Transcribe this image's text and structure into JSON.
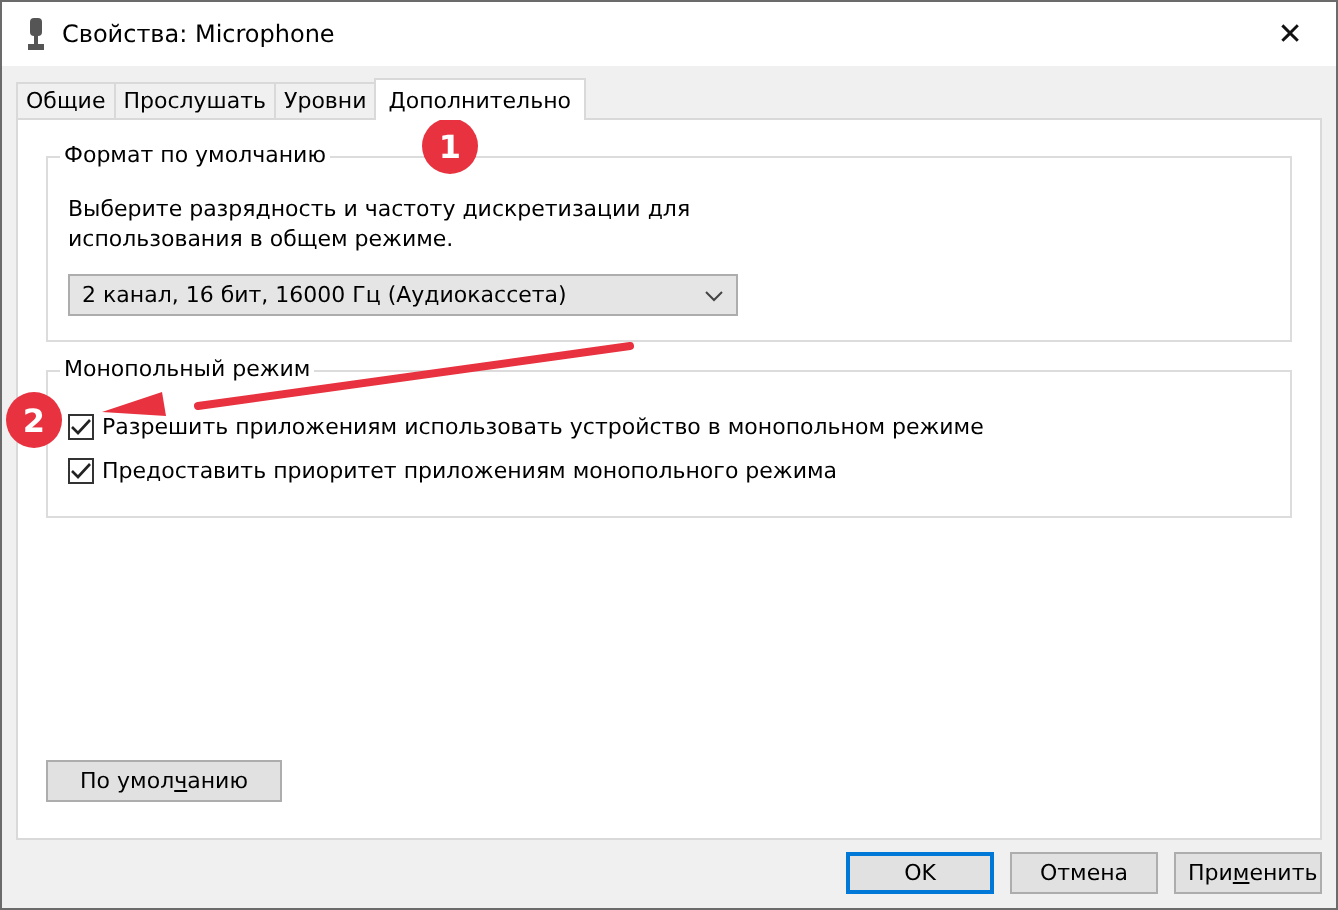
{
  "window": {
    "title": "Свойства: Microphone",
    "close": "✕"
  },
  "tabs": [
    {
      "label": "Общие",
      "selected": false
    },
    {
      "label": "Прослушать",
      "selected": false
    },
    {
      "label": "Уровни",
      "selected": false
    },
    {
      "label": "Дополнительно",
      "selected": true
    }
  ],
  "default_format": {
    "title": "Формат по умолчанию",
    "description": "Выберите разрядность и частоту дискретизации для использования в общем режиме.",
    "format_select": "2 канал, 16 бит, 16000 Гц (Аудиокассета)"
  },
  "exclusive_mode": {
    "title": "Монопольный режим",
    "options": [
      {
        "label": "Разрешить приложениям использовать устройство в монопольном режиме",
        "checked": true
      },
      {
        "label": "Предоставить приоритет приложениям монопольного режима",
        "checked": true
      }
    ]
  },
  "default_button": {
    "before": "По умол",
    "key": "ч",
    "after": "анию"
  },
  "buttons": [
    {
      "before": "OK",
      "default": true
    },
    {
      "before": "Отмена",
      "default": false
    },
    {
      "before": "При",
      "key": "м",
      "after": "енить",
      "default": false
    }
  ],
  "annotations": [
    {
      "kind": "badge",
      "number": "1"
    },
    {
      "kind": "badge",
      "number": "2"
    },
    {
      "kind": "arrow"
    }
  ]
}
